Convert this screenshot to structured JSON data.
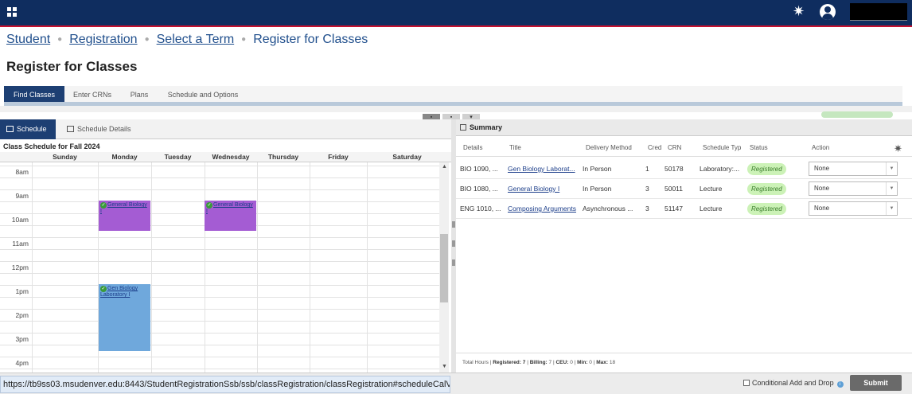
{
  "breadcrumb": {
    "items": [
      "Student",
      "Registration",
      "Select a Term"
    ],
    "current": "Register for Classes"
  },
  "page_title": "Register for Classes",
  "tabs": [
    "Find Classes",
    "Enter CRNs",
    "Plans",
    "Schedule and Options"
  ],
  "schedule_tabs": [
    "Schedule",
    "Schedule Details"
  ],
  "calendar": {
    "title": "Class Schedule for Fall 2024",
    "days": [
      "Sunday",
      "Monday",
      "Tuesday",
      "Wednesday",
      "Thursday",
      "Friday",
      "Saturday"
    ],
    "times": [
      "8am",
      "9am",
      "10am",
      "11am",
      "12pm",
      "1pm",
      "2pm",
      "3pm",
      "4pm"
    ],
    "events": [
      {
        "label": "General Biology I",
        "day": "Monday",
        "color": "#a45cd3"
      },
      {
        "label": "General Biology I",
        "day": "Wednesday",
        "color": "#a45cd3"
      },
      {
        "label": "Gen Biology Laboratory I",
        "day": "Monday",
        "color": "#6fa8dc"
      }
    ]
  },
  "summary": {
    "title": "Summary",
    "columns": [
      "Details",
      "Title",
      "Delivery Method",
      "Cred",
      "CRN",
      "Schedule Typ",
      "Status",
      "Action"
    ],
    "rows": [
      {
        "details": "BIO 1090, ...",
        "title": "Gen Biology Laborat...",
        "delivery": "In Person",
        "cred": "1",
        "crn": "50178",
        "type": "Laboratory:...",
        "status": "Registered",
        "action": "None"
      },
      {
        "details": "BIO 1080, ...",
        "title": "General Biology I",
        "delivery": "In Person",
        "cred": "3",
        "crn": "50011",
        "type": "Lecture",
        "status": "Registered",
        "action": "None"
      },
      {
        "details": "ENG 1010, ...",
        "title": "Composing Arguments",
        "delivery": "Asynchronous ...",
        "cred": "3",
        "crn": "51147",
        "type": "Lecture",
        "status": "Registered",
        "action": "None"
      }
    ],
    "totals": {
      "prefix": "Total Hours | ",
      "registered_label": "Registered:",
      "registered": "7",
      "billing_label": "Billing:",
      "billing": "7",
      "ceu_label": "CEU:",
      "ceu": "0",
      "min_label": "Min:",
      "min": "0",
      "max_label": "Max:",
      "max": "18"
    }
  },
  "status_url": "https://tb9ss03.msudenver.edu:8443/StudentRegistrationSsb/ssb/classRegistration/classRegistration#scheduleCalView",
  "footer": {
    "conditional_label": "Conditional Add and Drop",
    "submit_label": "Submit"
  },
  "colors": {
    "header_bg": "#0f2d5f",
    "accent_red": "#c8102e",
    "lecture_event": "#a45cd3",
    "lab_event": "#6fa8dc",
    "registered_badge": "#ccf2b7"
  }
}
